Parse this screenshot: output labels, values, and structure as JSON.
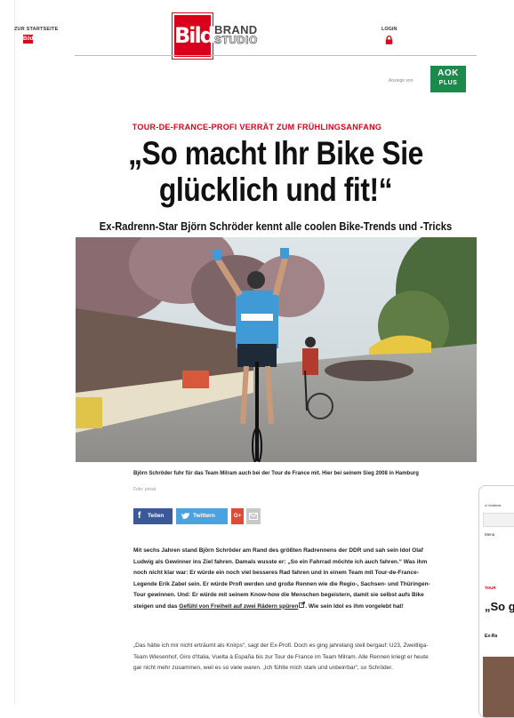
{
  "header": {
    "home_label": "ZUR STARTSEITE",
    "home_logo_text": "Bild",
    "logo_text": "Bild",
    "brand_line1": "BRAND",
    "brand_line2": "STUDIO",
    "login_label": "LOGIN"
  },
  "ad": {
    "label": "Anzeige von",
    "sponsor_line1": "AOK",
    "sponsor_line2": "PLUS"
  },
  "article": {
    "kicker": "TOUR-DE-FRANCE-PROFI VERRÄT ZUM FRÜHLINGSANFANG",
    "headline": "„So macht Ihr Bike Sie glücklich und fit!“",
    "subline": "Ex-Radrenn-Star Björn Schröder kennt alle coolen Bike-Trends und -Tricks",
    "caption": "Björn Schröder fuhr für das Team Milram auch bei der Tour de France mit. Hier bei seinem Sieg 2008 in Hamburg",
    "credit": "Foto: privat",
    "para1_a": "Mit sechs Jahren stand Björn Schröder am Rand des größten Radrennens der DDR und sah sein Idol Olaf Ludwig als Gewinner ins Ziel fahren. Damals wusste er: „So ein Fahrrad möchte ich auch fahren.“ Was ihm noch nicht klar war: Er würde ein noch viel besseres Rad fahren und in einem Team mit Tour-de-France-Legende Erik Zabel sein. Er würde Profi werden und große Rennen wie die Regio-, Sachsen- und Thüringen-Tour gewinnen. Und: Er würde mit seinem Know-how die Menschen begeistern, damit sie selbst aufs Bike steigen und das ",
    "para1_link": "Gefühl von Freiheit auf zwei Rädern spüren",
    "para1_b": ". Wie sein Idol es ihm vorgelebt hat!",
    "para2": "„Das hätte ich mir nicht erträumt als Knirps“, sagt der Ex-Profi. Doch es ging jahrelang steil bergauf: U23, Zweitliga-Team Wiesenhof, Giro d'Italia, Vuelta à España bis zur Tour de France im Team Milram. Alle Rennen kriegt er heute gar nicht mehr zusammen, weil es so viele waren. „Ich fühlte mich stark und unbeirrbar“, so Schröder."
  },
  "share": {
    "facebook_label": "Teilen",
    "twitter_label": "Twittern",
    "gplus_label": "G+"
  },
  "phone": {
    "status": "ııl Vodafone",
    "menu": "Menü",
    "kicker": "TOUR",
    "headline": "„So gl",
    "subline": "Ex-Ra"
  },
  "colors": {
    "bild_red": "#d8001a",
    "aok_green": "#1b8a4a",
    "facebook": "#3b5998",
    "twitter": "#4aa3df"
  }
}
